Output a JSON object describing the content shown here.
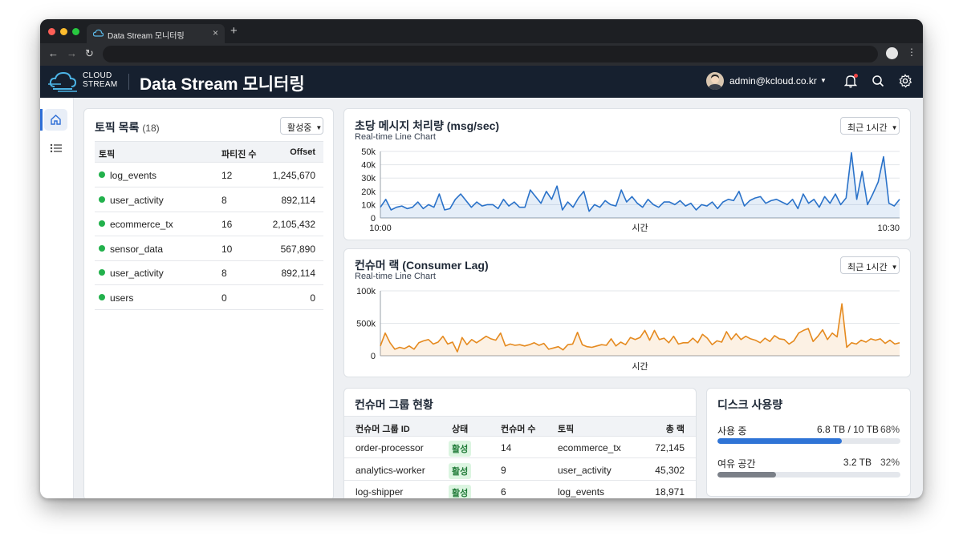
{
  "browser": {
    "tab_title": "Data Stream 모니터링",
    "tab_close": "×",
    "new_tab": "+"
  },
  "header": {
    "logo_line1": "CLOUD",
    "logo_line2": "STREAM",
    "title": "Data Stream 모니터링",
    "user_email": "admin@kcloud.co.kr"
  },
  "topics": {
    "title": "토픽 목록",
    "count": "(18)",
    "filter": "활성중",
    "columns": [
      "토픽",
      "파티진 수",
      "Offset"
    ],
    "rows": [
      {
        "name": "log_events",
        "partitions": "12",
        "offset": "1,245,670"
      },
      {
        "name": "user_activity",
        "partitions": "8",
        "offset": "892,114"
      },
      {
        "name": "ecommerce_tx",
        "partitions": "16",
        "offset": "2,105,432"
      },
      {
        "name": "sensor_data",
        "partitions": "10",
        "offset": "567,890"
      },
      {
        "name": "user_activity",
        "partitions": "8",
        "offset": "892,114"
      },
      {
        "name": "users",
        "partitions": "0",
        "offset": "0"
      }
    ]
  },
  "throughput": {
    "title": "초당 메시지 처리량 (msg/sec)",
    "subtitle": "Real-time Line Chart",
    "range": "최근 1시간"
  },
  "lag": {
    "title": "컨슈머 랙 (Consumer Lag)",
    "subtitle": "Real-time Line Chart",
    "range": "최근 1시간"
  },
  "chart_data": [
    {
      "type": "line",
      "title": "초당 메시지 처리량 (msg/sec)",
      "subtitle": "Real-time Line Chart",
      "xlabel": "시간",
      "ylabel": "",
      "x_ticks": [
        "10:00",
        "10:30"
      ],
      "y_ticks": [
        "0",
        "10k",
        "20k",
        "30k",
        "40k",
        "50k"
      ],
      "ylim": [
        0,
        50000
      ],
      "color": "#2a72c9",
      "series": [
        {
          "values": [
            8000,
            14000,
            6000,
            8000,
            9000,
            7000,
            8000,
            12000,
            7000,
            10000,
            8000,
            18000,
            6000,
            7000,
            14000,
            18000,
            13000,
            8000,
            12000,
            9000,
            10000,
            10000,
            7000,
            14000,
            9000,
            12000,
            8000,
            8000,
            21000,
            16000,
            11000,
            20000,
            14000,
            24000,
            6000,
            12000,
            8000,
            15000,
            20000,
            5000,
            10000,
            8000,
            13000,
            10000,
            9000,
            21000,
            12000,
            16000,
            11000,
            8000,
            14000,
            10000,
            8000,
            12000,
            12000,
            10000,
            13000,
            9000,
            11000,
            6000,
            10000,
            9000,
            12000,
            7000,
            12000,
            14000,
            13000,
            20000,
            9000,
            13000,
            15000,
            16000,
            11000,
            13000,
            14000,
            12000,
            10000,
            14000,
            7000,
            18000,
            11000,
            14000,
            8000,
            16000,
            11000,
            18000,
            10000,
            15000,
            49000,
            14000,
            35000,
            10000,
            18000,
            27000,
            46000,
            11000,
            9000,
            14000
          ]
        }
      ]
    },
    {
      "type": "line",
      "title": "컨슈머 랙 (Consumer Lag)",
      "subtitle": "Real-time Line Chart",
      "xlabel": "시간",
      "ylabel": "",
      "y_ticks": [
        "0",
        "500k",
        "100k"
      ],
      "ylim": [
        0,
        1000000
      ],
      "color": "#e58a1f",
      "series": [
        {
          "values": [
            150000,
            350000,
            200000,
            100000,
            130000,
            110000,
            150000,
            100000,
            200000,
            230000,
            250000,
            180000,
            210000,
            300000,
            180000,
            210000,
            60000,
            280000,
            170000,
            250000,
            200000,
            250000,
            300000,
            260000,
            240000,
            350000,
            150000,
            180000,
            160000,
            170000,
            150000,
            170000,
            200000,
            160000,
            190000,
            100000,
            120000,
            140000,
            90000,
            170000,
            180000,
            360000,
            170000,
            140000,
            130000,
            150000,
            170000,
            160000,
            260000,
            150000,
            210000,
            170000,
            280000,
            250000,
            280000,
            390000,
            240000,
            390000,
            250000,
            270000,
            200000,
            300000,
            180000,
            200000,
            200000,
            270000,
            200000,
            330000,
            270000,
            170000,
            230000,
            210000,
            370000,
            250000,
            340000,
            250000,
            300000,
            260000,
            240000,
            200000,
            270000,
            220000,
            310000,
            260000,
            250000,
            180000,
            230000,
            350000,
            390000,
            420000,
            220000,
            300000,
            400000,
            250000,
            350000,
            290000,
            800000,
            130000,
            200000,
            180000,
            240000,
            210000,
            260000,
            240000,
            260000,
            190000,
            240000,
            180000,
            200000
          ]
        }
      ]
    }
  ],
  "consumer_groups": {
    "title": "컨슈머 그룹 현황",
    "columns": [
      "컨슈머 그룹 ID",
      "상태",
      "컨슈머 수",
      "토픽",
      "총 랙"
    ],
    "rows": [
      {
        "id": "order-processor",
        "status": "활성",
        "consumers": "14",
        "topic": "ecommerce_tx",
        "lag": "72,145"
      },
      {
        "id": "analytics-worker",
        "status": "활성",
        "consumers": "9",
        "topic": "user_activity",
        "lag": "45,302"
      },
      {
        "id": "log-shipper",
        "status": "활성",
        "consumers": "6",
        "topic": "log_events",
        "lag": "18,971"
      }
    ]
  },
  "disk": {
    "title": "디스크 사용량",
    "used_label": "사용 중",
    "used_value": "6.8 TB / 10 TB",
    "used_pct": "68%",
    "used_fraction": 0.68,
    "used_color": "#2f74d6",
    "free_label": "여유 공간",
    "free_value": "3.2 TB",
    "free_pct": "32%",
    "free_fraction": 0.32,
    "free_color": "#7b8088"
  }
}
